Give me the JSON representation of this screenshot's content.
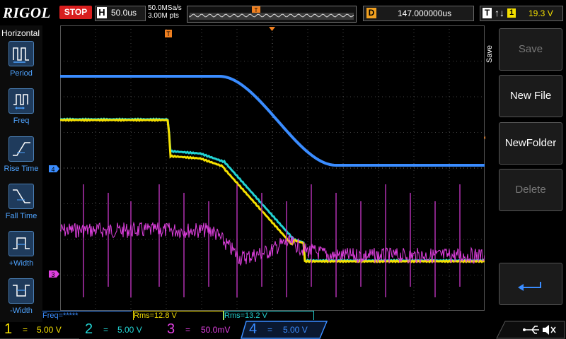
{
  "brand": "RIGOL",
  "status": "STOP",
  "horizontal": {
    "key": "H",
    "timebase": "50.0us",
    "sample_rate": "50.0MSa/s",
    "mem_depth": "3.00M pts"
  },
  "delay": {
    "key": "D",
    "value": "147.000000us"
  },
  "trigger": {
    "key": "T",
    "edge_symbol": "↑↓",
    "channel": "1",
    "level": "19.3 V"
  },
  "left_menu": {
    "title": "Horizontal",
    "items": [
      {
        "label": "Period"
      },
      {
        "label": "Freq"
      },
      {
        "label": "Rise Time"
      },
      {
        "label": "Fall Time"
      },
      {
        "label": "+Width"
      },
      {
        "label": "-Width"
      }
    ]
  },
  "right_menu": {
    "tab": "Save",
    "buttons": [
      {
        "label": "Save",
        "enabled": false
      },
      {
        "label": "New File",
        "enabled": true
      },
      {
        "label": "NewFolder",
        "enabled": true
      },
      {
        "label": "Delete",
        "enabled": false
      }
    ],
    "return_icon": "return-arrow-icon"
  },
  "markers": {
    "trigger": "T",
    "ch3": "3",
    "ch4": "4"
  },
  "measurements": [
    {
      "text": "Freq=*****",
      "color": "#3a8cff"
    },
    {
      "text": "Rms=12.8 V",
      "color": "#f5e000"
    },
    {
      "text": "Rms=13.2 V",
      "color": "#22d3d3"
    }
  ],
  "channels": [
    {
      "num": "1",
      "scale": "5.00 V",
      "color": "#f5e000",
      "active": false
    },
    {
      "num": "2",
      "scale": "5.00 V",
      "color": "#22d3d3",
      "active": false
    },
    {
      "num": "3",
      "scale": "50.0mV",
      "color": "#e040e0",
      "active": false
    },
    {
      "num": "4",
      "scale": "5.00 V",
      "color": "#3a8cff",
      "active": true
    }
  ],
  "status_icons": [
    "usb-icon",
    "speaker-mute-icon"
  ],
  "colors": {
    "ch1": "#f5e000",
    "ch2": "#22d3d3",
    "ch3": "#e040e0",
    "ch4": "#3a8cff",
    "trigger": "#f08020",
    "grid": "#555555"
  }
}
